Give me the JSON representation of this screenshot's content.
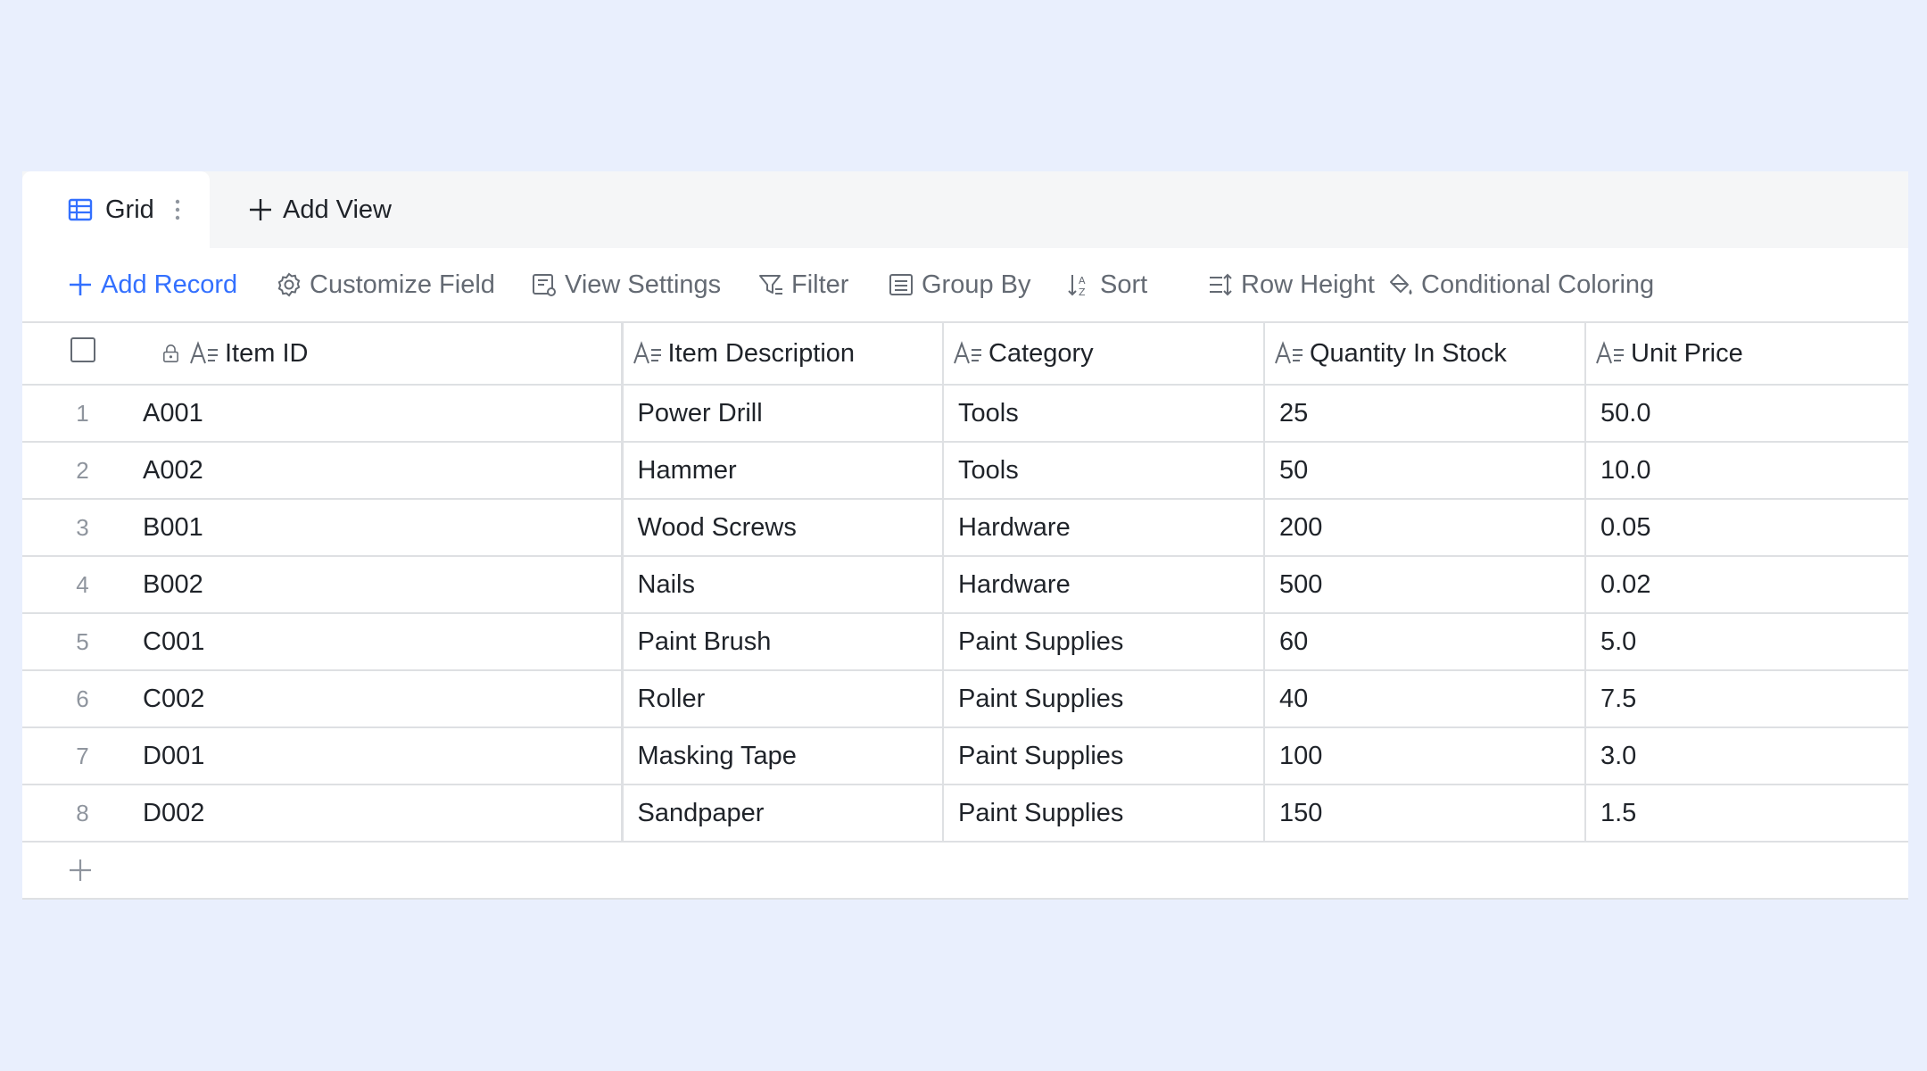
{
  "tabs": {
    "active_label": "Grid",
    "add_view_label": "Add View"
  },
  "toolbar": {
    "add_record": "Add Record",
    "customize_field": "Customize Field",
    "view_settings": "View Settings",
    "filter": "Filter",
    "group_by": "Group By",
    "sort": "Sort",
    "row_height": "Row Height",
    "conditional_coloring": "Conditional Coloring"
  },
  "colors": {
    "accent": "#3370ff",
    "page_bg": "#e9effd",
    "muted_text": "#646a73"
  },
  "table": {
    "columns": [
      "Item ID",
      "Item Description",
      "Category",
      "Quantity In Stock",
      "Unit Price"
    ],
    "rows": [
      {
        "n": "1",
        "cells": [
          "A001",
          "Power Drill",
          "Tools",
          "25",
          "50.0"
        ]
      },
      {
        "n": "2",
        "cells": [
          "A002",
          "Hammer",
          "Tools",
          "50",
          "10.0"
        ]
      },
      {
        "n": "3",
        "cells": [
          "B001",
          "Wood Screws",
          "Hardware",
          "200",
          "0.05"
        ]
      },
      {
        "n": "4",
        "cells": [
          "B002",
          "Nails",
          "Hardware",
          "500",
          "0.02"
        ]
      },
      {
        "n": "5",
        "cells": [
          "C001",
          "Paint Brush",
          "Paint Supplies",
          "60",
          "5.0"
        ]
      },
      {
        "n": "6",
        "cells": [
          "C002",
          "Roller",
          "Paint Supplies",
          "40",
          "7.5"
        ]
      },
      {
        "n": "7",
        "cells": [
          "D001",
          "Masking Tape",
          "Paint Supplies",
          "100",
          "3.0"
        ]
      },
      {
        "n": "8",
        "cells": [
          "D002",
          "Sandpaper",
          "Paint Supplies",
          "150",
          "1.5"
        ]
      }
    ]
  }
}
